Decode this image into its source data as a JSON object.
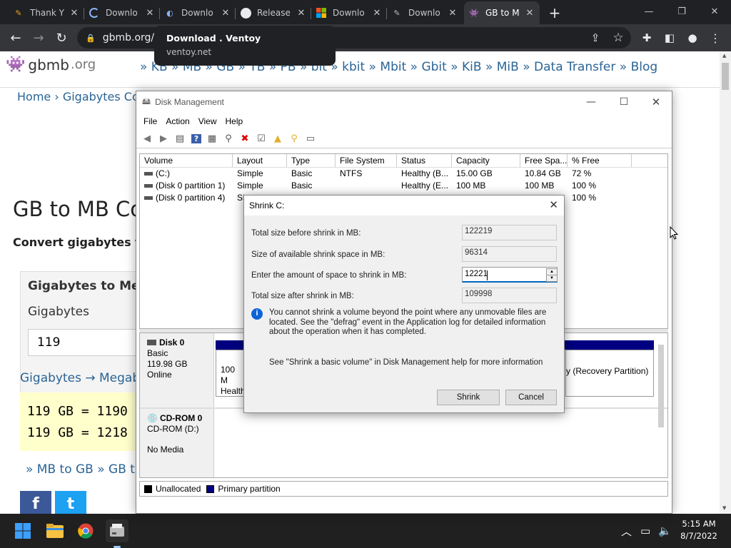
{
  "browser": {
    "tabs": [
      {
        "title": "Thank Y",
        "icon": "ventoy-favicon"
      },
      {
        "title": "Downlo",
        "icon": "loading-icon"
      },
      {
        "title": "Downlo",
        "icon": "ventoy-favicon"
      },
      {
        "title": "Release",
        "icon": "github-icon"
      },
      {
        "title": "Downlo",
        "icon": "microsoft-icon"
      },
      {
        "title": "Downlo",
        "icon": "ventoy-favicon"
      },
      {
        "title": "GB to M",
        "icon": "gbmb-favicon",
        "active": true
      }
    ],
    "new_tab": "+",
    "url": "gbmb.org/g",
    "tooltip": {
      "title": "Download . Ventoy",
      "domain": "ventoy.net"
    }
  },
  "website": {
    "logo_text": "gbmb",
    "logo_suffix": ".org",
    "nav_links": "» KB » MB » GB » TB » PB » bit » kbit » Mbit » Gbit » KiB » MiB » Data Transfer » Blog",
    "breadcrumb": "Home › Gigabytes Con",
    "title": "GB to MB Con",
    "subtitle": "Convert gigabytes to",
    "calc_heading": "Gigabytes to Mega",
    "calc_label": "Gigabytes",
    "calc_value": "119",
    "gb_link": "Gigabytes → Megab",
    "result_lines": [
      "119 GB = 1190",
      "119 GB = 1218"
    ],
    "bottom_links": "» MB to GB » GB to",
    "social": [
      "f",
      "t"
    ]
  },
  "disk_management": {
    "title": "Disk Management",
    "menu": [
      "File",
      "Action",
      "View",
      "Help"
    ],
    "columns": [
      "Volume",
      "Layout",
      "Type",
      "File System",
      "Status",
      "Capacity",
      "Free Spa...",
      "% Free"
    ],
    "volumes": [
      [
        "(C:)",
        "Simple",
        "Basic",
        "NTFS",
        "Healthy (B...",
        "15.00 GB",
        "10.84 GB",
        "72 %"
      ],
      [
        "(Disk 0 partition 1)",
        "Simple",
        "Basic",
        "",
        "Healthy (E...",
        "100 MB",
        "100 MB",
        "100 %"
      ],
      [
        "(Disk 0 partition 4)",
        "Si",
        "",
        "",
        "",
        "",
        "",
        "100 %"
      ]
    ],
    "disks": [
      {
        "name": "Disk 0",
        "type": "Basic",
        "size": "119.98 GB",
        "state": "Online",
        "part_size": "100 M",
        "part_status": "Health",
        "recovery": "y (Recovery Partition)"
      },
      {
        "name": "CD-ROM 0",
        "type": "CD-ROM (D:)",
        "media": "No Media"
      }
    ],
    "legend": {
      "unallocated": "Unallocated",
      "primary": "Primary partition",
      "unallocated_color": "#000000",
      "primary_color": "#000080"
    }
  },
  "shrink_dialog": {
    "title": "Shrink C:",
    "fields": [
      {
        "label": "Total size before shrink in MB:",
        "value": "122219"
      },
      {
        "label": "Size of available shrink space in MB:",
        "value": "96314"
      },
      {
        "label": "Enter the amount of space to shrink in MB:",
        "value": "12221"
      },
      {
        "label": "Total size after shrink in MB:",
        "value": "109998"
      }
    ],
    "info": "You cannot shrink a volume beyond the point where any unmovable files are located. See the \"defrag\" event in the Application log for detailed information about the operation when it has completed.",
    "help": "See \"Shrink a basic volume\" in Disk Management help for more information",
    "shrink_button": "Shrink",
    "cancel_button": "Cancel"
  },
  "taskbar": {
    "time": "5:15 AM",
    "date": "8/7/2022"
  }
}
